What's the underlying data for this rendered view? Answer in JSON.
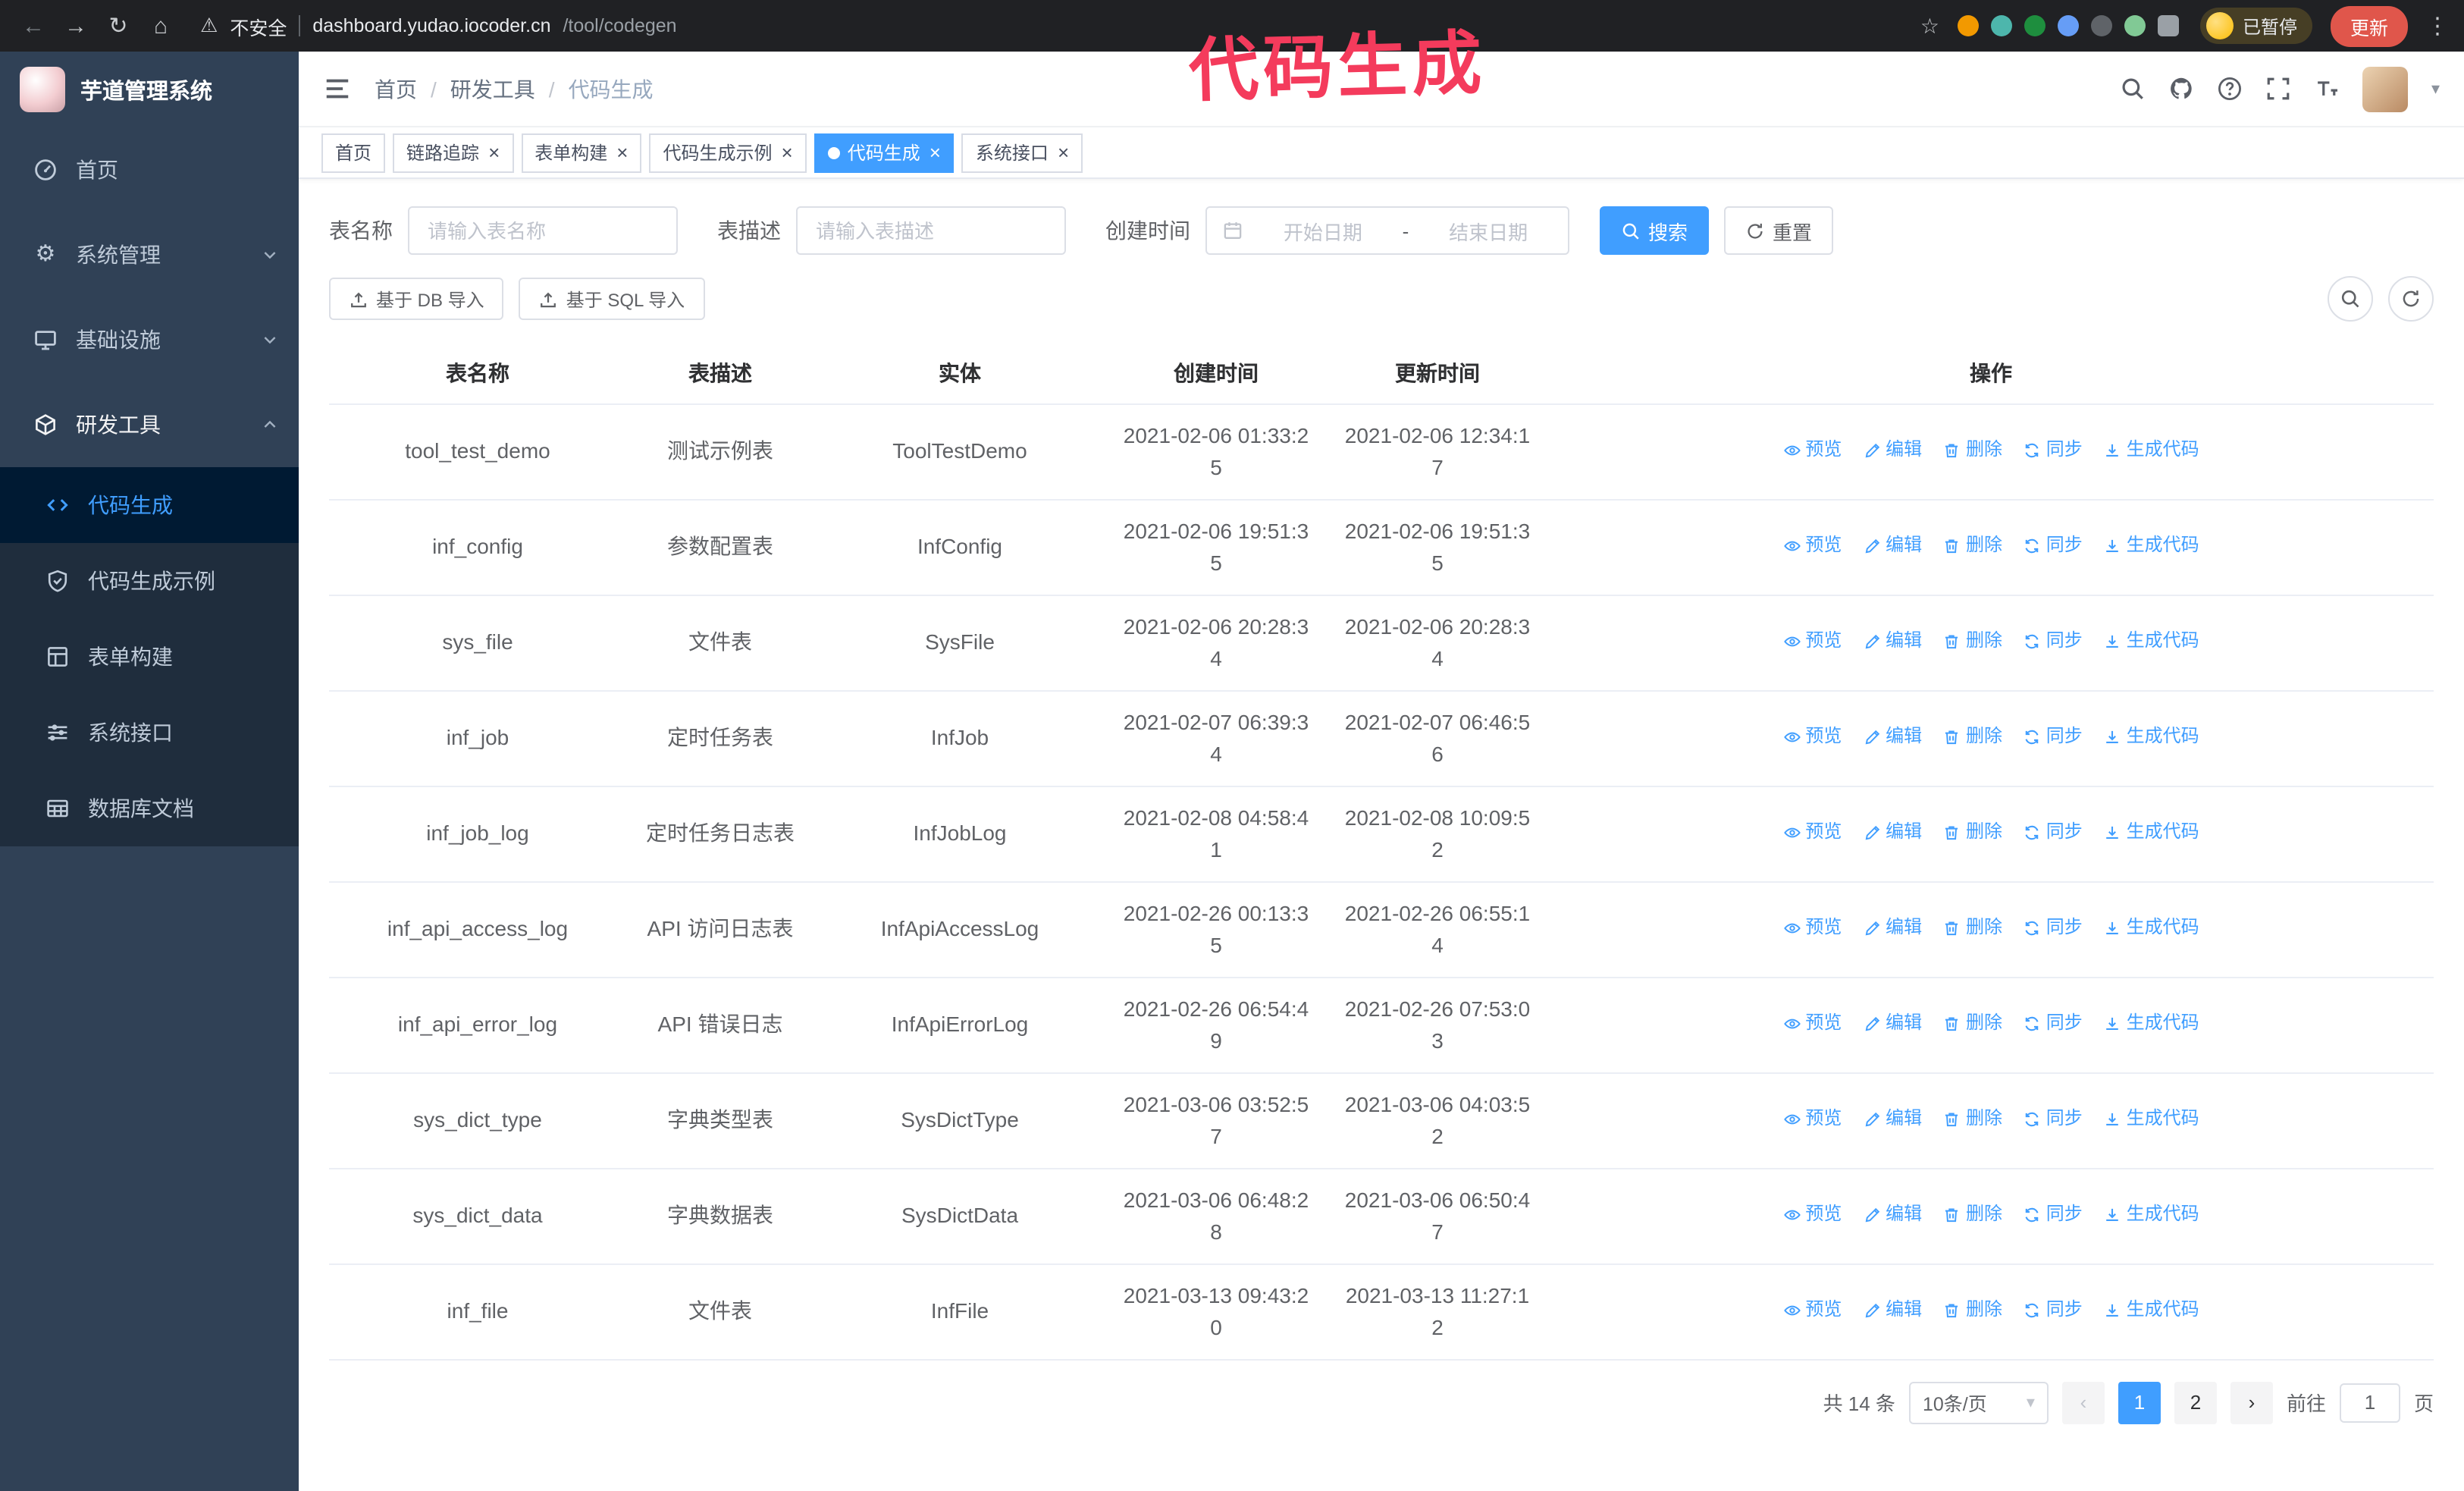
{
  "browser": {
    "security_warning": "不安全",
    "url_host": "dashboard.yudao.iocoder.cn",
    "url_path": "/tool/codegen",
    "profile_status": "已暂停",
    "update_button": "更新"
  },
  "annotation": {
    "text": "代码生成",
    "color": "#f43b5c"
  },
  "icons": {
    "back": "←",
    "forward": "→",
    "reload": "↻",
    "home": "⌂",
    "warning": "⚠",
    "star": "☆",
    "kebab": "⋮",
    "gear": "⚙",
    "caret_down": "▾",
    "close": "×"
  },
  "colors": {
    "primary": "#409EFF",
    "sidebar_bg": "#304156",
    "submenu_bg": "#1f2d3d",
    "submenu_active_bg": "#001a33",
    "link": "#409EFF"
  },
  "sidebar": {
    "logo_title": "芋道管理系统",
    "items": [
      {
        "label": "首页"
      },
      {
        "label": "系统管理"
      },
      {
        "label": "基础设施"
      },
      {
        "label": "研发工具",
        "expanded": true
      }
    ],
    "subitems": [
      {
        "label": "代码生成",
        "active": true
      },
      {
        "label": "代码生成示例"
      },
      {
        "label": "表单构建"
      },
      {
        "label": "系统接口"
      },
      {
        "label": "数据库文档"
      }
    ]
  },
  "header": {
    "breadcrumb": [
      "首页",
      "研发工具",
      "代码生成"
    ],
    "separator": "/"
  },
  "tabs": [
    {
      "label": "首页"
    },
    {
      "label": "链路追踪",
      "closable": true
    },
    {
      "label": "表单构建",
      "closable": true
    },
    {
      "label": "代码生成示例",
      "closable": true
    },
    {
      "label": "代码生成",
      "closable": true,
      "active": true
    },
    {
      "label": "系统接口",
      "closable": true
    }
  ],
  "filters": {
    "table_name_label": "表名称",
    "table_name_placeholder": "请输入表名称",
    "table_desc_label": "表描述",
    "table_desc_placeholder": "请输入表描述",
    "create_time_label": "创建时间",
    "date_start_placeholder": "开始日期",
    "date_separator": "-",
    "date_end_placeholder": "结束日期",
    "search_button": "搜索",
    "reset_button": "重置"
  },
  "toolbar": {
    "import_db_button": "基于 DB 导入",
    "import_sql_button": "基于 SQL 导入"
  },
  "table": {
    "columns": [
      "表名称",
      "表描述",
      "实体",
      "创建时间",
      "更新时间",
      "操作"
    ],
    "row_actions": [
      "预览",
      "编辑",
      "删除",
      "同步",
      "生成代码"
    ],
    "rows": [
      {
        "name": "tool_test_demo",
        "desc": "测试示例表",
        "entity": "ToolTestDemo",
        "created": "2021-02-06 01:33:25",
        "updated": "2021-02-06 12:34:17"
      },
      {
        "name": "inf_config",
        "desc": "参数配置表",
        "entity": "InfConfig",
        "created": "2021-02-06 19:51:35",
        "updated": "2021-02-06 19:51:35"
      },
      {
        "name": "sys_file",
        "desc": "文件表",
        "entity": "SysFile",
        "created": "2021-02-06 20:28:34",
        "updated": "2021-02-06 20:28:34"
      },
      {
        "name": "inf_job",
        "desc": "定时任务表",
        "entity": "InfJob",
        "created": "2021-02-07 06:39:34",
        "updated": "2021-02-07 06:46:56"
      },
      {
        "name": "inf_job_log",
        "desc": "定时任务日志表",
        "entity": "InfJobLog",
        "created": "2021-02-08 04:58:41",
        "updated": "2021-02-08 10:09:52"
      },
      {
        "name": "inf_api_access_log",
        "desc": "API 访问日志表",
        "entity": "InfApiAccessLog",
        "created": "2021-02-26 00:13:35",
        "updated": "2021-02-26 06:55:14"
      },
      {
        "name": "inf_api_error_log",
        "desc": "API 错误日志",
        "entity": "InfApiErrorLog",
        "created": "2021-02-26 06:54:49",
        "updated": "2021-02-26 07:53:03"
      },
      {
        "name": "sys_dict_type",
        "desc": "字典类型表",
        "entity": "SysDictType",
        "created": "2021-03-06 03:52:57",
        "updated": "2021-03-06 04:03:52"
      },
      {
        "name": "sys_dict_data",
        "desc": "字典数据表",
        "entity": "SysDictData",
        "created": "2021-03-06 06:48:28",
        "updated": "2021-03-06 06:50:47"
      },
      {
        "name": "inf_file",
        "desc": "文件表",
        "entity": "InfFile",
        "created": "2021-03-13 09:43:20",
        "updated": "2021-03-13 11:27:12"
      }
    ]
  },
  "pagination": {
    "total": "共 14 条",
    "page_size": "10条/页",
    "prev_icon": "‹",
    "next_icon": "›",
    "pages": [
      "1",
      "2"
    ],
    "active_page": "1",
    "goto_label": "前往",
    "goto_value": "1",
    "goto_unit": "页"
  }
}
